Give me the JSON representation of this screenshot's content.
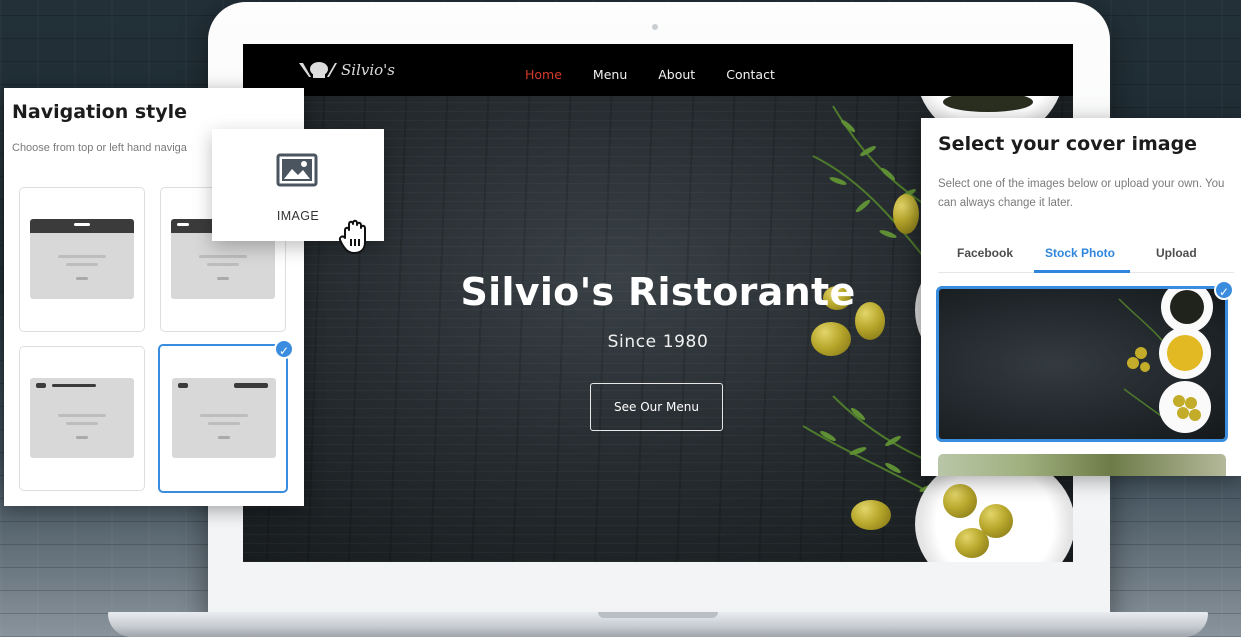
{
  "website": {
    "logo_text": "Silvio's",
    "nav": [
      "Home",
      "Menu",
      "About",
      "Contact"
    ],
    "active_nav": "Home",
    "hero_title": "Silvio's Ristorante",
    "hero_subtitle": "Since 1980",
    "hero_button": "See Our Menu"
  },
  "navigation_style_panel": {
    "title": "Navigation style",
    "description": "Choose from top or left hand naviga",
    "selected_option": 4
  },
  "image_widget": {
    "icon": "image-icon",
    "label": "IMAGE"
  },
  "cover_panel": {
    "title": "Select your cover image",
    "description": "Select one of the images below or upload your own. You can always change it later.",
    "tabs": [
      "Facebook",
      "Stock Photo",
      "Upload"
    ],
    "active_tab": "Stock Photo",
    "selected_thumbnail": 1
  },
  "colors": {
    "accent_blue": "#3a8dde",
    "active_nav_red": "#d23a2a"
  }
}
